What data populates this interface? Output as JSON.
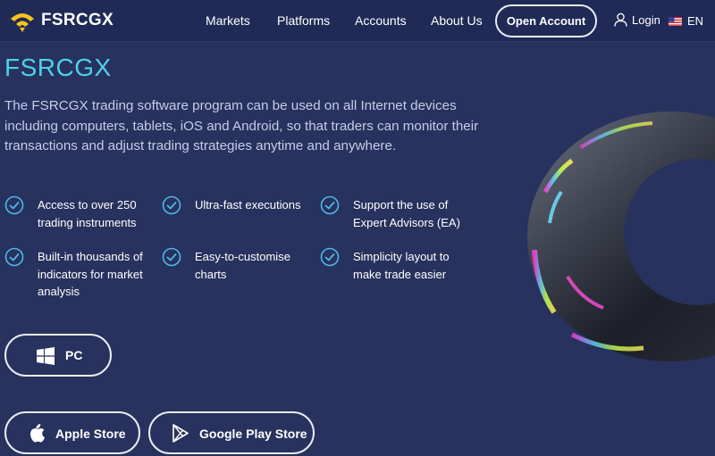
{
  "brand": {
    "name": "FSRCGX"
  },
  "nav": {
    "items": [
      "Markets",
      "Platforms",
      "Accounts",
      "About Us"
    ],
    "open_account": "Open Account",
    "login": "Login",
    "language": "EN"
  },
  "hero": {
    "title": "FSRCGX",
    "description": "The FSRCGX trading software program can be used on all Internet devices including computers, tablets, iOS and Android, so that traders can monitor their transactions and adjust trading strategies anytime and anywhere."
  },
  "features": [
    {
      "line1": "Access to over 250",
      "line2": "trading instruments",
      "line3": ""
    },
    {
      "line1": "Ultra-fast executions",
      "line2": "",
      "line3": ""
    },
    {
      "line1": "Support the use of",
      "line2": "Expert Advisors (EA)",
      "line3": ""
    },
    {
      "line1": "Built-in thousands of",
      "line2": "indicators for market",
      "line3": "analysis"
    },
    {
      "line1": "Easy-to-customise",
      "line2": "charts",
      "line3": ""
    },
    {
      "line1": "Simplicity layout to",
      "line2": "make trade easier",
      "line3": ""
    }
  ],
  "downloads": {
    "pc": "PC",
    "apple": "Apple Store",
    "google": "Google Play Store"
  },
  "colors": {
    "background": "#27325e",
    "navbar": "#1f2b56",
    "title_accent": "#4fd0e8",
    "check_accent": "#4fb8e8",
    "logo_yellow": "#f5c518"
  }
}
